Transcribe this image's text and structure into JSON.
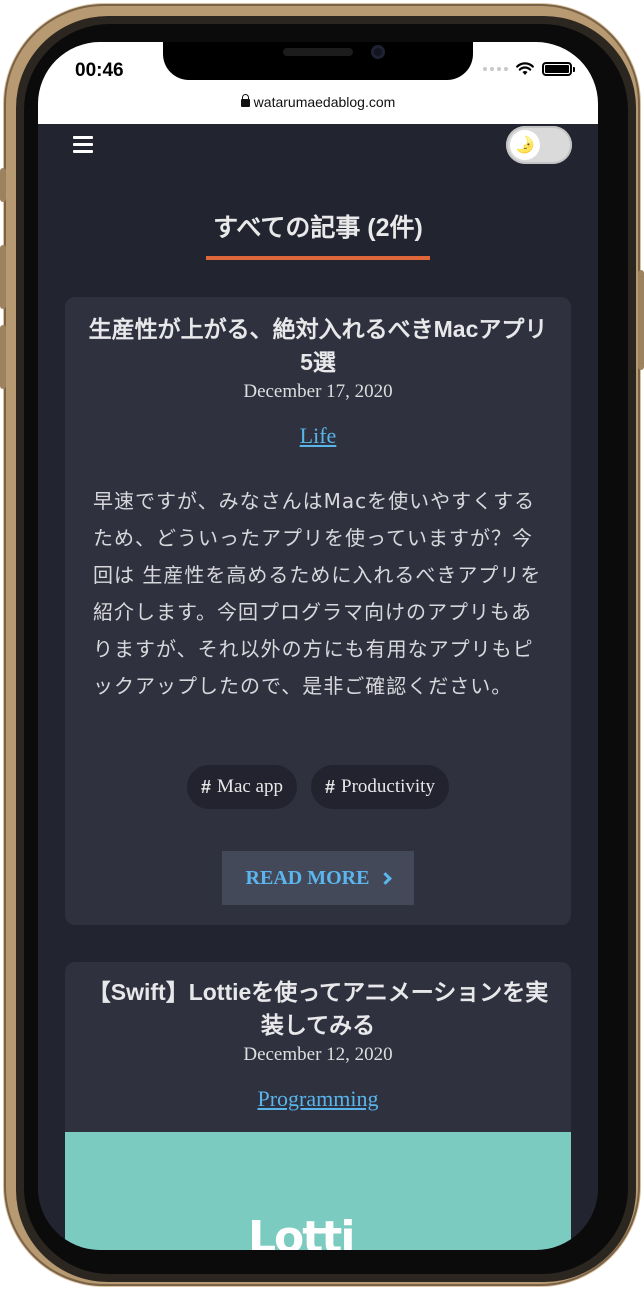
{
  "status": {
    "time": "00:46",
    "url": "watarumaedablog.com"
  },
  "header": {
    "menu_icon": "hamburger-icon",
    "theme_toggle_icon": "moon-icon",
    "theme_toggle_glyph": "🌛"
  },
  "page": {
    "title": "すべての記事 (2件)",
    "accent_color": "#e0673a",
    "link_color": "#58b5ea"
  },
  "posts": [
    {
      "title": "生産性が上がる、絶対入れるべきMacアプリ5選",
      "date": "December 17, 2020",
      "category": "Life",
      "excerpt": "早速ですが、みなさんはMacを使いやすくするため、どういったアプリを使っていますが？今回は 生産性を高めるために入れるべきアプリを紹介します。今回プログラマ向けのアプリもありますが、それ以外の方にも有用なアプリもピックアップしたので、是非ご確認ください。",
      "tags": [
        "Mac app",
        "Productivity"
      ],
      "read_more": "READ MORE"
    },
    {
      "title": "【Swift】Lottieを使ってアニメーションを実装してみる",
      "date": "December 12, 2020",
      "category": "Programming",
      "thumb_text": "Lotti"
    }
  ]
}
